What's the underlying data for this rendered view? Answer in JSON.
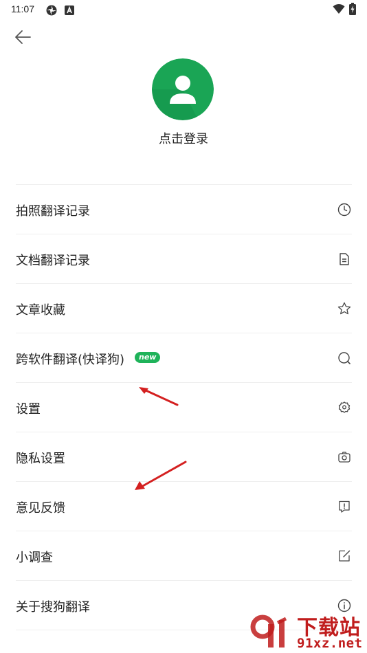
{
  "status_bar": {
    "time": "11:07",
    "icons": [
      "pinwheel-icon",
      "a-notification-icon",
      "wifi-icon",
      "battery-charging-icon"
    ]
  },
  "header": {
    "back_icon": "arrow-left-icon"
  },
  "profile": {
    "avatar_icon": "user-icon",
    "login_label": "点击登录",
    "accent_color": "#1aa555"
  },
  "menu": {
    "items": [
      {
        "label": "拍照翻译记录",
        "icon": "clock-icon"
      },
      {
        "label": "文档翻译记录",
        "icon": "document-icon"
      },
      {
        "label": "文章收藏",
        "icon": "star-icon"
      },
      {
        "label": "跨软件翻译(快译狗)",
        "icon": "search-icon",
        "badge": "new"
      },
      {
        "label": "设置",
        "icon": "gear-icon"
      },
      {
        "label": "隐私设置",
        "icon": "camera-lock-icon"
      },
      {
        "label": "意见反馈",
        "icon": "feedback-icon"
      },
      {
        "label": "小调查",
        "icon": "edit-icon"
      },
      {
        "label": "关于搜狗翻译",
        "icon": "info-icon"
      }
    ]
  },
  "watermark": {
    "title": "下载站",
    "url": "91xz.net"
  }
}
